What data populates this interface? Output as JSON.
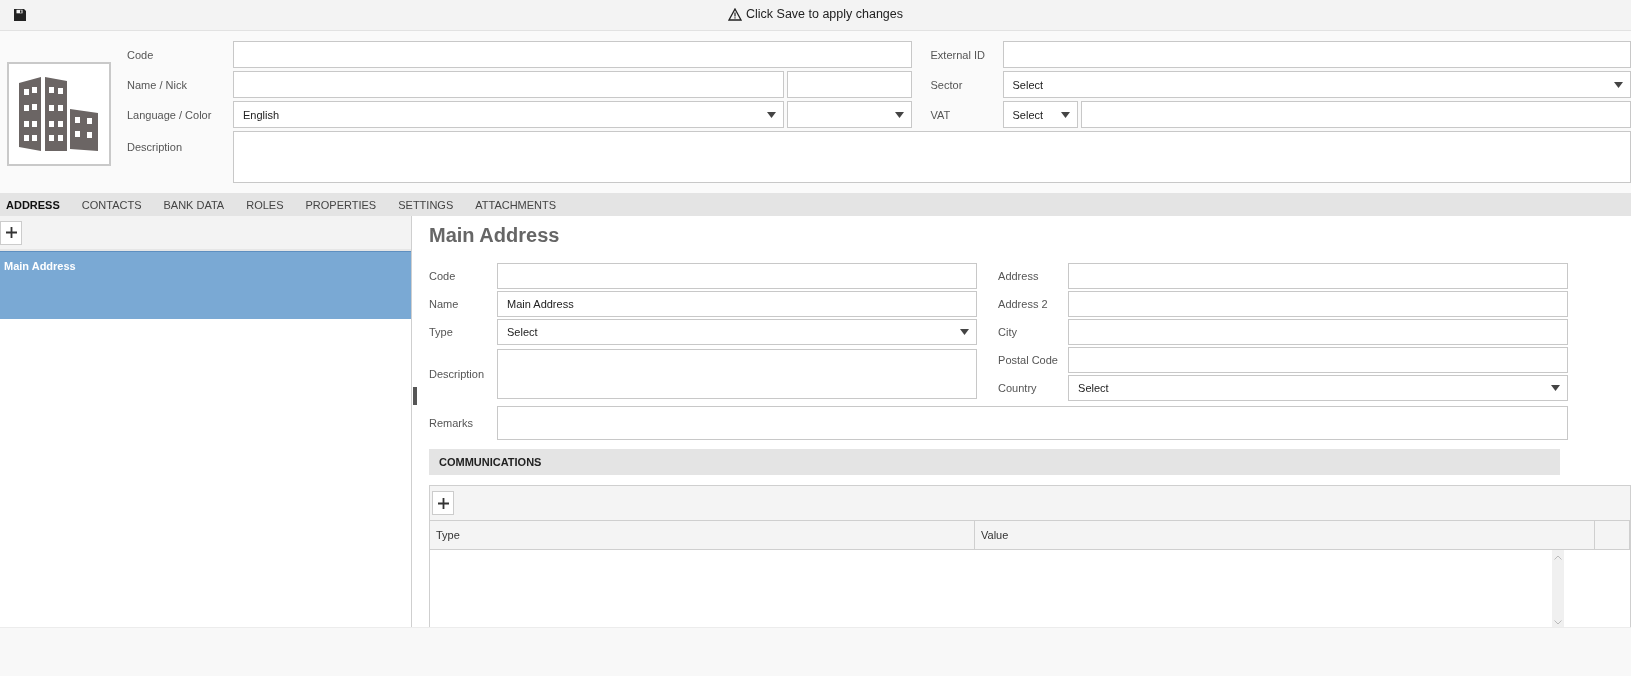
{
  "toolbar": {
    "notice": "Click Save to apply changes"
  },
  "header": {
    "code_label": "Code",
    "name_label": "Name / Nick",
    "language_label": "Language / Color",
    "language_value": "English",
    "description_label": "Description",
    "external_id_label": "External ID",
    "sector_label": "Sector",
    "sector_value": "Select",
    "vat_label": "VAT",
    "vat_value": "Select"
  },
  "tabs": [
    {
      "label": "ADDRESS",
      "selected": true
    },
    {
      "label": "CONTACTS",
      "selected": false
    },
    {
      "label": "BANK DATA",
      "selected": false
    },
    {
      "label": "ROLES",
      "selected": false
    },
    {
      "label": "PROPERTIES",
      "selected": false
    },
    {
      "label": "SETTINGS",
      "selected": false
    },
    {
      "label": "ATTACHMENTS",
      "selected": false
    }
  ],
  "addresses": [
    {
      "name": "Main Address",
      "selected": true
    }
  ],
  "detail": {
    "title": "Main Address",
    "left_fields": [
      {
        "label": "Code",
        "kind": "text"
      },
      {
        "label": "Name",
        "kind": "text",
        "value": "Main Address"
      },
      {
        "label": "Type",
        "kind": "select",
        "value": "Select"
      },
      {
        "label": "Description",
        "kind": "textarea"
      }
    ],
    "right_fields": [
      {
        "label": "Address",
        "kind": "text"
      },
      {
        "label": "Address 2",
        "kind": "text"
      },
      {
        "label": "City",
        "kind": "text"
      },
      {
        "label": "Postal Code",
        "kind": "text"
      },
      {
        "label": "Country",
        "kind": "select",
        "value": "Select"
      }
    ],
    "remarks_label": "Remarks"
  },
  "communications": {
    "title": "COMMUNICATIONS",
    "columns": [
      "Type",
      "Value"
    ]
  }
}
